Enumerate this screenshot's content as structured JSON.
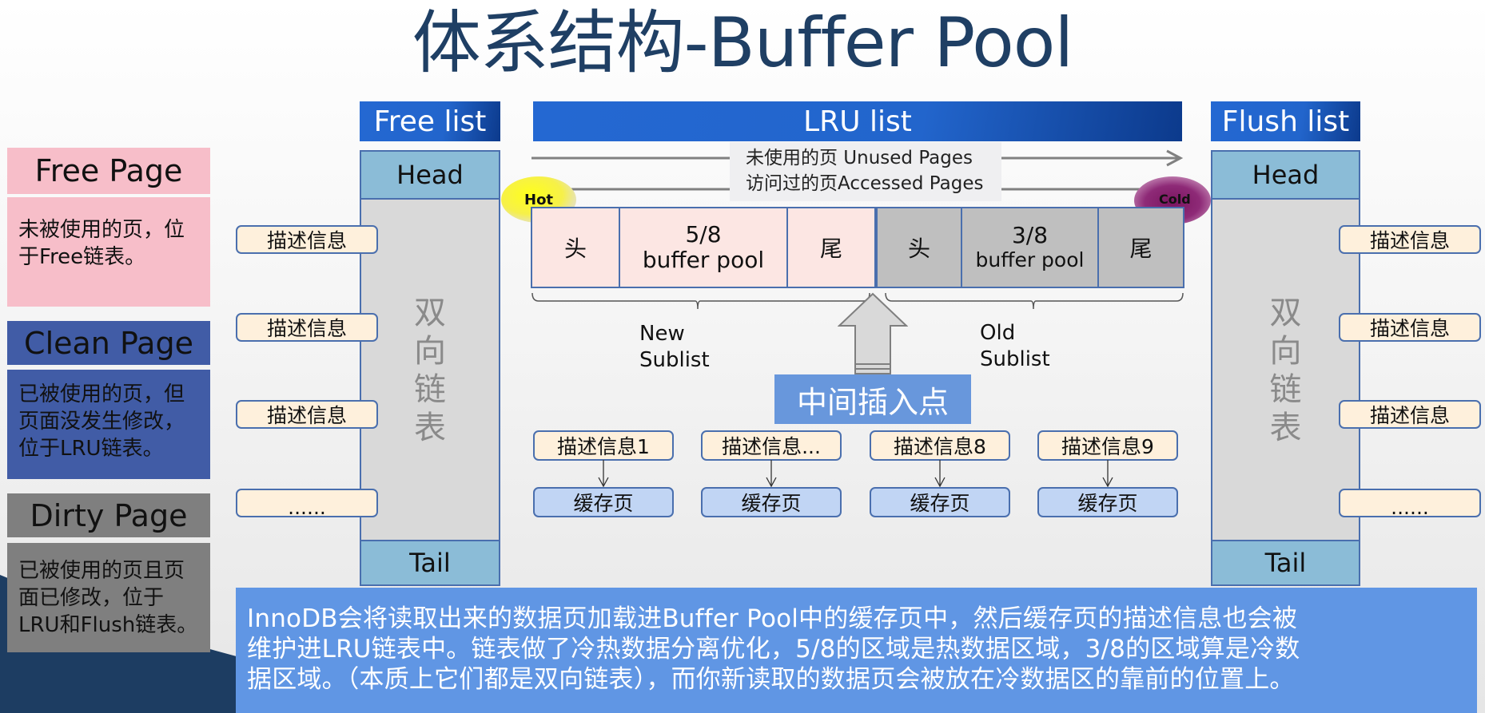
{
  "title": "体系结构-Buffer Pool",
  "legend": [
    {
      "heading": "Free Page",
      "description": "未被使用的页，位于Free链表。",
      "color": "#f7bec9"
    },
    {
      "heading": "Clean Page",
      "description": "已被使用的页，但页面没发生修改，位于LRU链表。",
      "color": "#415ca6"
    },
    {
      "heading": "Dirty Page",
      "description": "已被使用的页且页面已修改，位于LRU和Flush链表。",
      "color": "#7f7f7f"
    }
  ],
  "free_list": {
    "header": "Free list",
    "head": "Head",
    "tail": "Tail",
    "body_label": [
      "双",
      "向",
      "链",
      "表"
    ],
    "descriptors": [
      "描述信息",
      "描述信息",
      "描述信息",
      "......"
    ]
  },
  "flush_list": {
    "header": "Flush list",
    "head": "Head",
    "tail": "Tail",
    "body_label": [
      "双",
      "向",
      "链",
      "表"
    ],
    "descriptors": [
      "描述信息",
      "描述信息",
      "描述信息",
      "......"
    ]
  },
  "lru_list": {
    "header": "LRU list",
    "arrow_legend": {
      "unused": "未使用的页 Unused Pages",
      "accessed": "访问过的页Accessed Pages"
    },
    "hot_label": "Hot",
    "cold_label": "Cold",
    "new_region": {
      "head": "头",
      "fraction": "5/8",
      "caption": "buffer pool",
      "tail": "尾"
    },
    "old_region": {
      "head": "头",
      "fraction": "3/8",
      "caption": "buffer pool",
      "tail": "尾"
    },
    "new_sublist": [
      "New",
      "Sublist"
    ],
    "old_sublist": [
      "Old",
      "Sublist"
    ],
    "insert_point": "中间插入点",
    "nodes": [
      {
        "descriptor": "描述信息1",
        "page": "缓存页"
      },
      {
        "descriptor": "描述信息...",
        "page": "缓存页"
      },
      {
        "descriptor": "描述信息8",
        "page": "缓存页"
      },
      {
        "descriptor": "描述信息9",
        "page": "缓存页"
      }
    ]
  },
  "explanation": [
    "InnoDB会将读取出来的数据页加载进Buffer Pool中的缓存页中，然后缓存页的描述信息也会被",
    "维护进LRU链表中。链表做了冷热数据分离优化，5/8的区域是热数据区域，3/8的区域算是冷数",
    "据区域。（本质上它们都是双向链表），而你新读取的数据页会被放在冷数据区的靠前的位置上。"
  ],
  "colors": {
    "title": "#1f3f64",
    "header_blue": "#2265cc",
    "cap_blue": "#8bbcd7",
    "insert_blue": "#6897dc",
    "explain_blue": "#6096e4",
    "hot_cell": "#fce6e3",
    "cold_cell": "#bfbfbf"
  }
}
